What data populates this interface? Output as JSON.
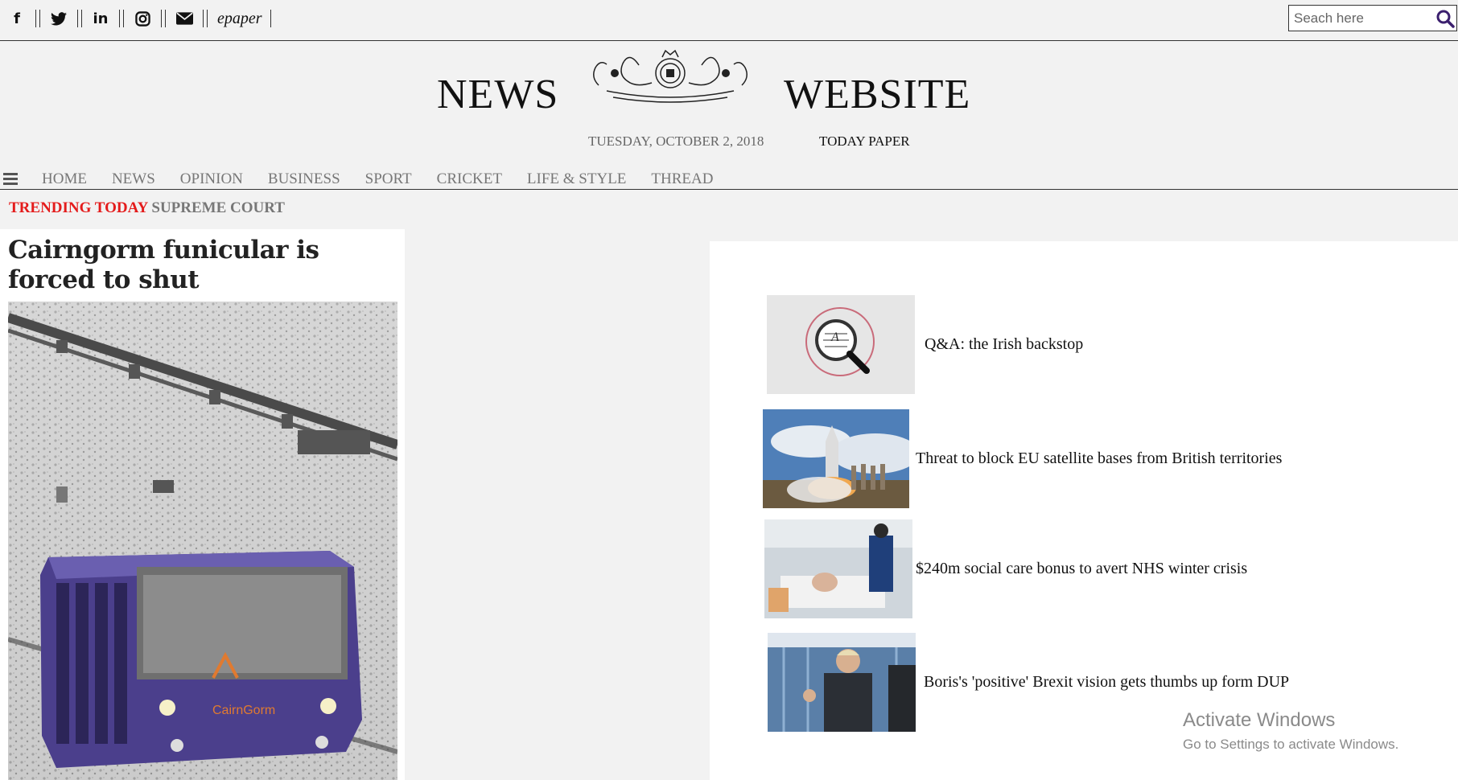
{
  "topbar": {
    "social": [
      {
        "icon": "facebook-icon",
        "glyph": "f"
      },
      {
        "icon": "twitter-icon",
        "glyph": ""
      },
      {
        "icon": "linkedin-icon",
        "glyph": "in"
      },
      {
        "icon": "instagram-icon",
        "glyph": ""
      },
      {
        "icon": "envelope-icon",
        "glyph": ""
      }
    ],
    "epaper_label": "epaper",
    "search_placeholder": "Seach here"
  },
  "masthead": {
    "title_left": "NEWS",
    "title_right": "WEBSITE",
    "date": "TUESDAY, OCTOBER 2, 2018",
    "today_paper": "TODAY PAPER"
  },
  "nav": {
    "items": [
      "HOME",
      "NEWS",
      "OPINION",
      "BUSINESS",
      "SPORT",
      "CRICKET",
      "LIFE & STYLE",
      "THREAD"
    ]
  },
  "trending": {
    "label": "TRENDING TODAY",
    "topic": "SUPREME COURT"
  },
  "main_story": {
    "headline": "Cairngorm funicular is forced to shut",
    "train_logo_text": "CairnGorm"
  },
  "side_stories": [
    {
      "title": "Q&A: the Irish backstop",
      "thumb_icon": "magnifier-icon"
    },
    {
      "title": "Threat to block EU satellite bases from British territories",
      "thumb_icon": "rocket-launch-image"
    },
    {
      "title": "$240m social care bonus to avert NHS winter crisis",
      "thumb_icon": "hospital-patient-image"
    },
    {
      "title": "Boris's 'positive' Brexit vision gets thumbs up form DUP",
      "thumb_icon": "politician-image"
    }
  ],
  "watermark": {
    "line1": "Activate Windows",
    "line2": "Go to Settings to activate Windows."
  },
  "colors": {
    "background": "#f2f2f2",
    "trending_red": "#e41b1b",
    "nav_grey": "#777777",
    "search_icon_purple": "#3b1f6e"
  }
}
